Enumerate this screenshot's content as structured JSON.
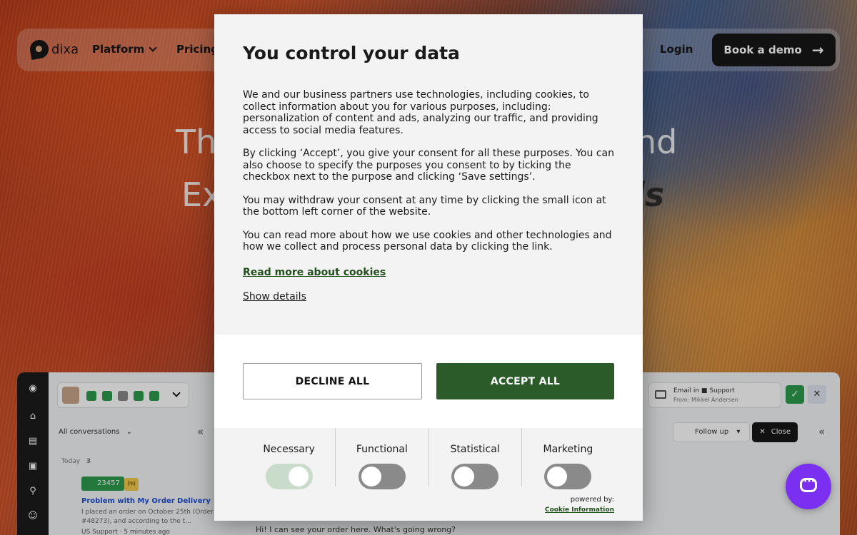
{
  "nav": {
    "logo_text": "dixa",
    "platform_label": "Platform",
    "pricing_label": "Pricing",
    "login_label": "Login",
    "demo_label": "Book a demo"
  },
  "hero": {
    "line1_left": "Th",
    "line1_right": "nd",
    "line2_left": "Ex",
    "line2_right": "ds"
  },
  "app_preview": {
    "conversations_label": "All conversations",
    "today_label": "Today",
    "today_count": "3",
    "ticket_id": "23457",
    "ticket_badge": "PM",
    "ticket_title": "Problem with My Order Delivery",
    "ticket_text": "I placed an order on October 25th (Order #48273), and according to the t...",
    "ticket_meta": "US Support  ·  5 minutes ago",
    "chat_message": "Hi! I can see your order here. What's going wrong?",
    "email_title": "Email in ■ Support",
    "email_from": "From: Mikkel Andersen",
    "follow_up_label": "Follow up",
    "close_label": "Close",
    "right_partial": "t"
  },
  "cookie": {
    "title": "You control your data",
    "paragraphs": [
      "We and our business partners use technologies, including cookies, to collect information about you for various purposes, including: personalization of content and ads, analyzing our traffic, and providing access to social media features.",
      "By clicking ‘Accept’, you give your consent for all these purposes. You can also choose to specify the purposes you consent to by ticking the checkbox next to the purpose and clicking ‘Save settings’.",
      "You may withdraw your consent at any time by clicking the small icon at the bottom left corner of the website.",
      "You can read more about how we use cookies and other technologies and how we collect and process personal data by clicking the link."
    ],
    "read_more_label": "Read more about cookies",
    "show_details_label": "Show details",
    "decline_label": "DECLINE ALL",
    "accept_label": "ACCEPT ALL",
    "categories": [
      {
        "label": "Necessary",
        "enabled": true
      },
      {
        "label": "Functional",
        "enabled": false
      },
      {
        "label": "Statistical",
        "enabled": false
      },
      {
        "label": "Marketing",
        "enabled": false
      }
    ],
    "powered_by_label": "powered by:",
    "powered_by_link": "Cookie Information"
  },
  "colors": {
    "accept_green": "#2b5b29",
    "link_green": "#234f1e",
    "chat_fab": "#7b2ff0"
  }
}
